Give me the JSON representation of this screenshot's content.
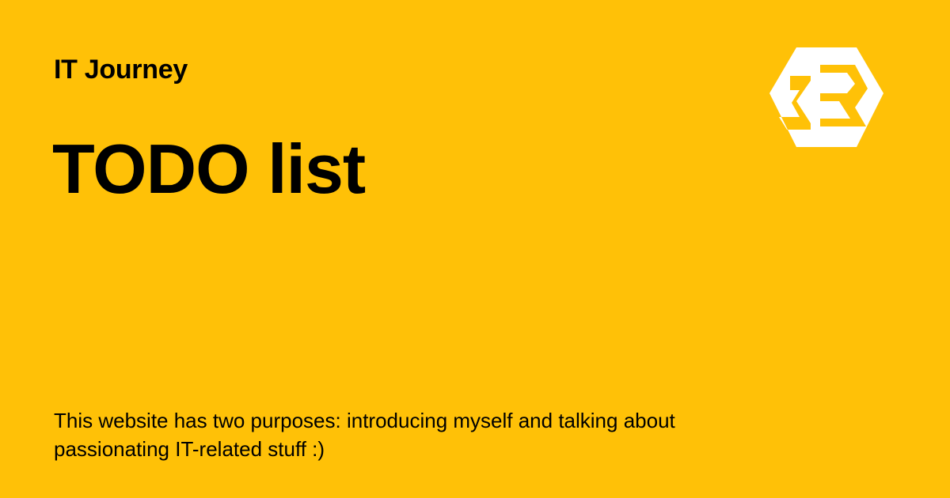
{
  "header": {
    "site_name": "IT Journey"
  },
  "main": {
    "title": "TODO list",
    "description": "This website has two purposes: introducing myself and talking about passionating IT-related stuff :)"
  },
  "logo": {
    "icon": "hexagon-logo-icon",
    "color": "#FFFFFF"
  },
  "colors": {
    "background": "#FFC107",
    "text": "#000000"
  }
}
